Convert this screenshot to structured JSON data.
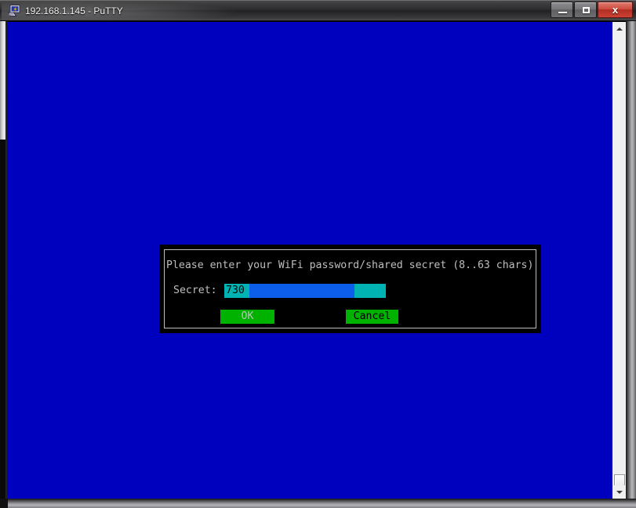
{
  "window": {
    "title": "192.168.1.145 - PuTTY",
    "icon": "putty-icon",
    "controls": {
      "minimize_label": "Minimize",
      "maximize_label": "Maximize",
      "close_label": "x"
    }
  },
  "terminal": {
    "background_color": "#0000bf",
    "scrollbar": {
      "up_arrow": "scroll-up",
      "down_arrow": "scroll-down"
    }
  },
  "dialog": {
    "prompt": "Please enter your WiFi password/shared secret (8..63 chars)",
    "field_label": "Secret:",
    "input": {
      "value": "730",
      "placeholder": "",
      "field_color": "#00b3b3",
      "fill_color": "#0b5fea"
    },
    "buttons": {
      "ok_label": "OK",
      "cancel_label": "Cancel",
      "button_color": "#00b200"
    },
    "border_color": "#bfbfbf",
    "background_color": "#000000",
    "text_color": "#bfbfbf"
  }
}
